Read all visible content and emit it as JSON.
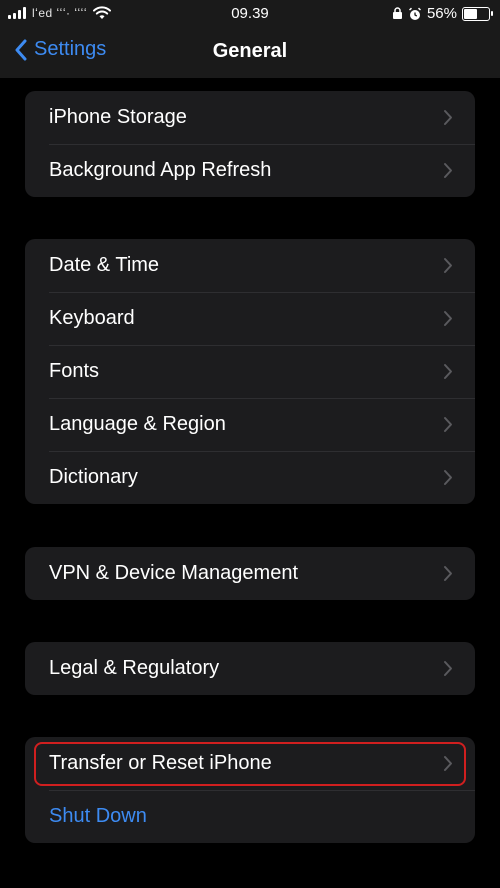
{
  "status_bar": {
    "carrier": "lʻed ʻʻʻ· ʻʻʻʻ",
    "time": "09.39",
    "battery": "56%",
    "battery_level": 0.56
  },
  "nav": {
    "back_label": "Settings",
    "title": "General"
  },
  "groups": {
    "storage": [
      "iPhone Storage",
      "Background App Refresh"
    ],
    "locale": [
      "Date & Time",
      "Keyboard",
      "Fonts",
      "Language & Region",
      "Dictionary"
    ],
    "vpn": [
      "VPN & Device Management"
    ],
    "legal": [
      "Legal & Regulatory"
    ],
    "reset": {
      "transfer": "Transfer or Reset iPhone",
      "shutdown": "Shut Down"
    }
  },
  "colors": {
    "accent": "#3d8bf2",
    "highlight": "#d01f1f",
    "cell_bg": "#1c1c1e"
  }
}
